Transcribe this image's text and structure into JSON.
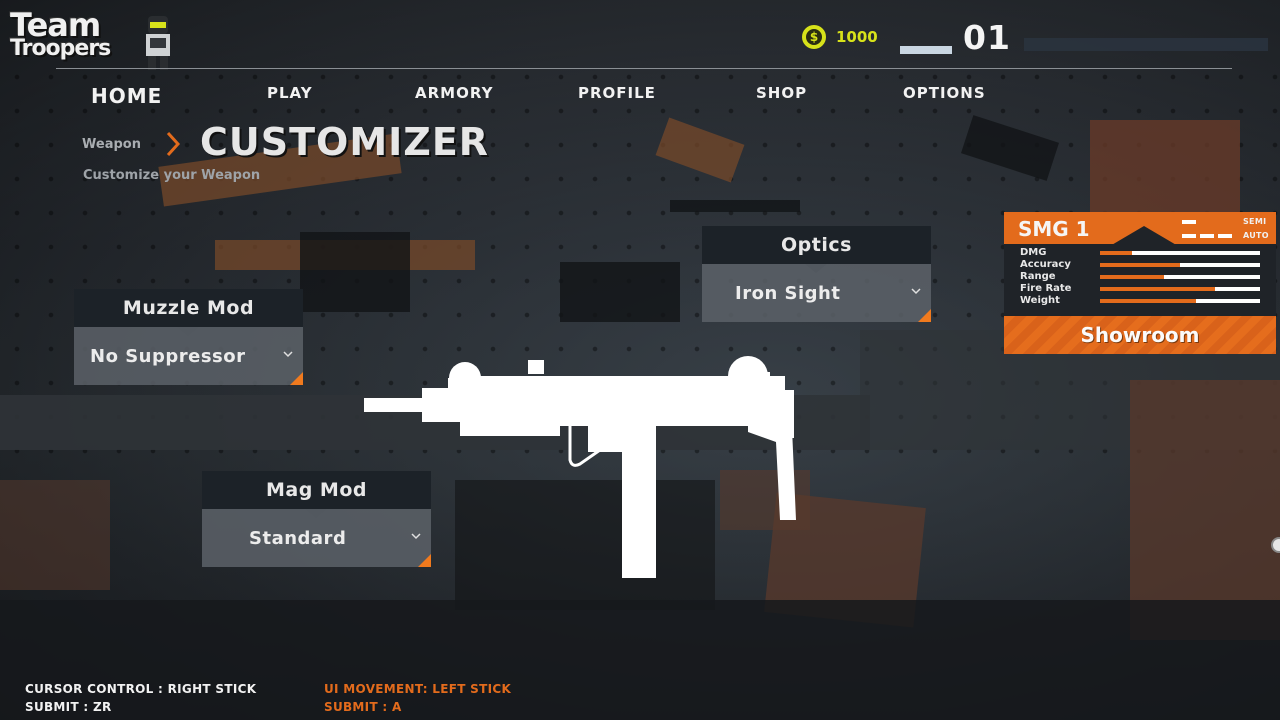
{
  "logo": {
    "line1": "Team",
    "line2": "Troopers"
  },
  "header": {
    "coins": "1000",
    "level": "01",
    "level_progress": 0.0
  },
  "nav": {
    "items": [
      {
        "label": "HOME",
        "active": true
      },
      {
        "label": "PLAY"
      },
      {
        "label": "ARMORY"
      },
      {
        "label": "PROFILE"
      },
      {
        "label": "SHOP"
      },
      {
        "label": "OPTIONS"
      }
    ]
  },
  "breadcrumb": {
    "parent": "Weapon",
    "title": "CUSTOMIZER",
    "subtitle": "Customize your Weapon"
  },
  "mods": {
    "muzzle": {
      "label": "Muzzle Mod",
      "value": "No Suppressor"
    },
    "optics": {
      "label": "Optics",
      "value": "Iron Sight"
    },
    "mag": {
      "label": "Mag Mod",
      "value": "Standard"
    }
  },
  "weapon_card": {
    "name": "SMG 1",
    "modes": [
      "SEMI",
      "AUTO"
    ],
    "stats": [
      {
        "label": "DMG",
        "value": 0.2
      },
      {
        "label": "Accuracy",
        "value": 0.5
      },
      {
        "label": "Range",
        "value": 0.4
      },
      {
        "label": "Fire Rate",
        "value": 0.72
      },
      {
        "label": "Weight",
        "value": 0.6
      }
    ],
    "showroom_label": "Showroom"
  },
  "hints": {
    "left_line1": "CURSOR CONTROL : RIGHT STICK",
    "left_line2": "SUBMIT : ZR",
    "right_line1": "UI MOVEMENT: LEFT STICK",
    "right_line2": "SUBMIT : A"
  },
  "colors": {
    "accent": "#e36b1c",
    "coin": "#d7e21a",
    "panel": "#1c2228"
  }
}
